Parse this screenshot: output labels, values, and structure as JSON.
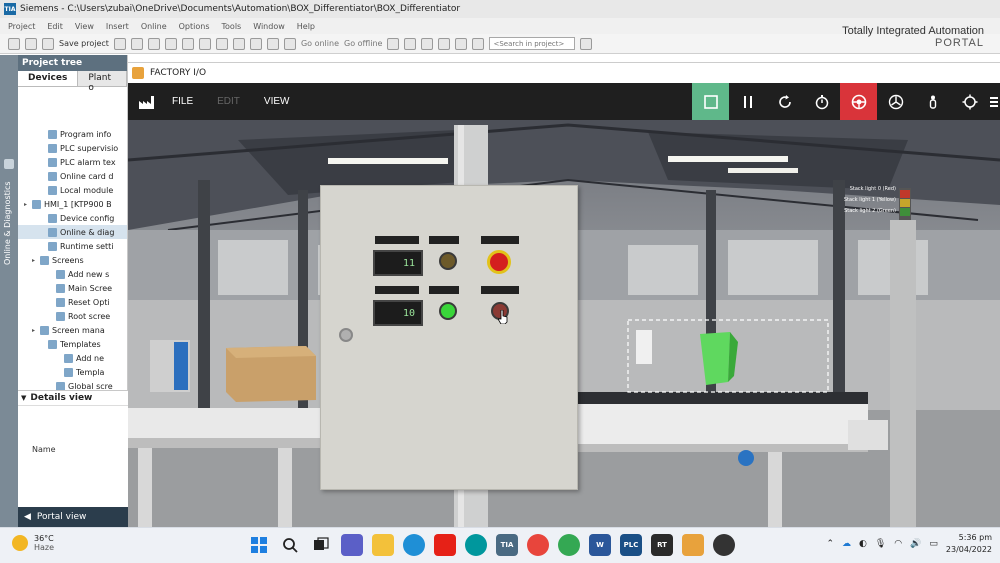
{
  "tia": {
    "title": "Siemens  -  C:\\Users\\zubai\\OneDrive\\Documents\\Automation\\BOX_Differentiator\\BOX_Differentiator",
    "menu": [
      "Project",
      "Edit",
      "View",
      "Insert",
      "Online",
      "Options",
      "Tools",
      "Window",
      "Help"
    ],
    "toolbar": {
      "save_project": "Save project",
      "go_online": "Go online",
      "go_offline": "Go offline",
      "search_placeholder": "<Search in project>"
    },
    "brand_line1": "Totally Integrated Automation",
    "brand_line2": "PORTAL",
    "side_strip": "Online & Diagnostics",
    "project_tree": {
      "header": "Project tree",
      "tabs": [
        "Devices",
        "Plant o"
      ],
      "items": [
        {
          "label": "Program info",
          "indent": 2
        },
        {
          "label": "PLC supervisio",
          "indent": 2
        },
        {
          "label": "PLC alarm tex",
          "indent": 2
        },
        {
          "label": "Online card d",
          "indent": 2
        },
        {
          "label": "Local module",
          "indent": 2
        },
        {
          "label": "HMI_1 [KTP900 B",
          "indent": 0
        },
        {
          "label": "Device config",
          "indent": 2
        },
        {
          "label": "Online & diag",
          "indent": 2
        },
        {
          "label": "Runtime setti",
          "indent": 2
        },
        {
          "label": "Screens",
          "indent": 1
        },
        {
          "label": "Add new s",
          "indent": 3
        },
        {
          "label": "Main Scree",
          "indent": 3
        },
        {
          "label": "Reset Opti",
          "indent": 3
        },
        {
          "label": "Root scree",
          "indent": 3
        },
        {
          "label": "Screen mana",
          "indent": 1
        },
        {
          "label": "Templates",
          "indent": 2
        },
        {
          "label": "Add ne",
          "indent": 4
        },
        {
          "label": "Templa",
          "indent": 4
        },
        {
          "label": "Global scre",
          "indent": 3
        }
      ]
    },
    "details_view": "Details view",
    "details_column": "Name",
    "portal_view": "Portal view"
  },
  "factory_io": {
    "window_title": "FACTORY I/O",
    "menu": [
      "FILE",
      "EDIT",
      "VIEW"
    ],
    "toolbar_icons": [
      "play-icon",
      "pause-icon",
      "reset-icon",
      "timer-icon",
      "driver-icon",
      "fan-icon",
      "person-icon",
      "target-icon",
      "more-icon"
    ],
    "panel": {
      "display_1": "11",
      "display_2": "10"
    },
    "stack_light_labels": [
      "Stack light 0 (Red)",
      "Stack light 1 (Yellow)",
      "Stack light 2 (Green)"
    ]
  },
  "taskbar": {
    "temperature": "36°C",
    "weather": "Haze",
    "time": "5:36 pm",
    "date": "23/04/2022",
    "apps": [
      "Start",
      "Search",
      "Task View",
      "Teams",
      "File Explorer",
      "Edge",
      "YouTube",
      "Arduino",
      "TIA",
      "Chrome",
      "Chrome",
      "Word",
      "PLCSIM",
      "WinCC RT",
      "Factory IO",
      "OBS"
    ]
  },
  "colors": {
    "tia_header": "#5d707f",
    "fio_play": "#5fb88a",
    "fio_driver": "#d9343a",
    "fio_toolbar": "#1f1f1f"
  }
}
